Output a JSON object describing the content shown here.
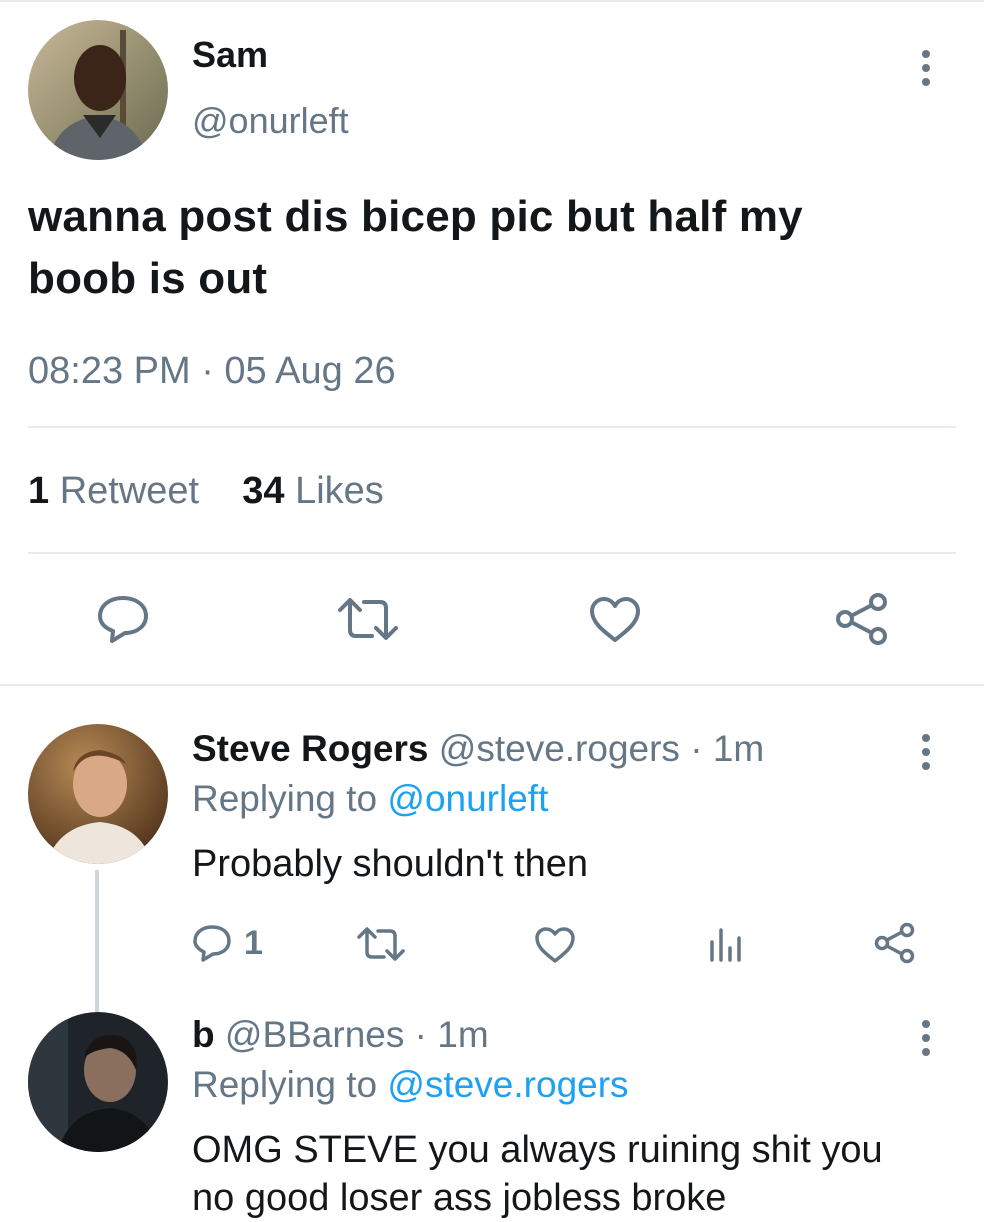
{
  "main_tweet": {
    "author_name": "Sam",
    "author_handle": "@onurleft",
    "text_line1": "wanna post dis bicep pic but half my",
    "text_line2": "boob is out",
    "timestamp": "08:23 PM · 05 Aug 26",
    "retweets_count": "1",
    "retweets_label": "Retweet",
    "likes_count": "34",
    "likes_label": "Likes"
  },
  "replies": [
    {
      "author_name": "Steve Rogers",
      "author_handle": "@steve.rogers · 1m",
      "replying_prefix": "Replying to",
      "replying_to": "@onurleft",
      "text": "Probably shouldn't then",
      "reply_count": "1"
    },
    {
      "author_name": "b",
      "author_handle": "@BBarnes · 1m",
      "replying_prefix": "Replying to",
      "replying_to": "@steve.rogers",
      "text_line1": "OMG STEVE you always ruining shit you",
      "text_line2": "no good loser ass jobless broke"
    }
  ],
  "icons": {
    "reply": "reply-icon",
    "retweet": "retweet-icon",
    "like": "heart-icon",
    "share": "share-icon",
    "analytics": "analytics-icon",
    "more": "more-icon"
  },
  "colors": {
    "link": "#1da1f2",
    "secondary_text": "#657786",
    "divider": "#e6ecf0"
  }
}
